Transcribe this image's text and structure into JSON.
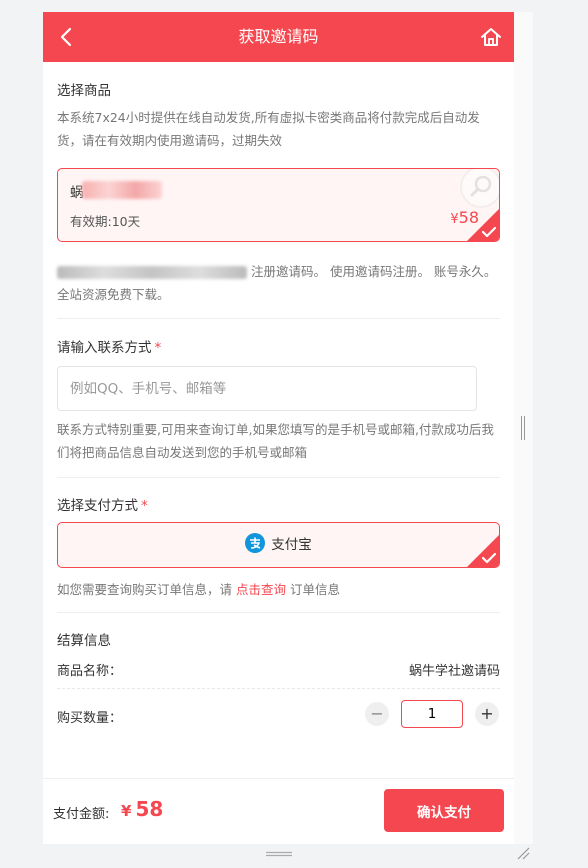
{
  "header": {
    "title": "获取邀请码",
    "back_icon": "chevron-left-icon",
    "home_icon": "home-icon"
  },
  "product": {
    "section_title": "选择商品",
    "description": "本系统7x24小时提供在线自动发货,所有虚拟卡密类商品将付款完成后自动发货，请在有效期内使用邀请码，过期失效",
    "card": {
      "name_first_char": "蜗",
      "validity": "有效期:10天",
      "currency": "¥",
      "price": "58"
    },
    "note": "注册邀请码。 使用邀请码注册。 账号永久。全站资源免费下载。"
  },
  "contact": {
    "section_title": "请输入联系方式",
    "required_mark": "*",
    "placeholder": "例如QQ、手机号、邮箱等",
    "hint": "联系方式特别重要,可用来查询订单,如果您填写的是手机号或邮箱,付款成功后我们将把商品信息自动发送到您的手机号或邮箱"
  },
  "payment": {
    "section_title": "选择支付方式",
    "required_mark": "*",
    "method": "支付宝",
    "query_prefix": "如您需要查询购买订单信息，请",
    "query_link": "点击查询",
    "query_suffix": "订单信息"
  },
  "settlement": {
    "section_title": "结算信息",
    "product_label": "商品名称：",
    "product_value": "蜗牛学社邀请码",
    "quantity_label": "购买数量：",
    "quantity": "1",
    "minus": "−",
    "plus": "+"
  },
  "footer": {
    "total_label": "支付金额:",
    "currency": "¥",
    "total": "58",
    "confirm_label": "确认支付"
  },
  "colors": {
    "accent": "#f5474f",
    "alipay": "#1296db"
  }
}
